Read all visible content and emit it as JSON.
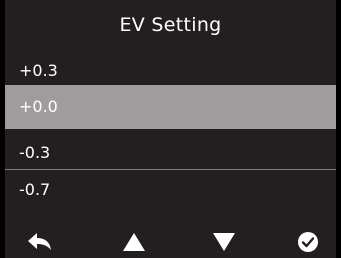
{
  "title": "EV Setting",
  "options": [
    {
      "label": "+0.3",
      "selected": false
    },
    {
      "label": "+0.0",
      "selected": true
    },
    {
      "label": "-0.3",
      "selected": false
    },
    {
      "label": "-0.7",
      "selected": false
    }
  ],
  "footer": {
    "back_icon": "back-arrow-icon",
    "up_icon": "up-triangle-icon",
    "down_icon": "down-triangle-icon",
    "confirm_icon": "check-circle-icon"
  },
  "colors": {
    "background": "#231f20",
    "selection": "#a09c9d",
    "text": "#ffffff",
    "divider": "#7f7b7c"
  }
}
